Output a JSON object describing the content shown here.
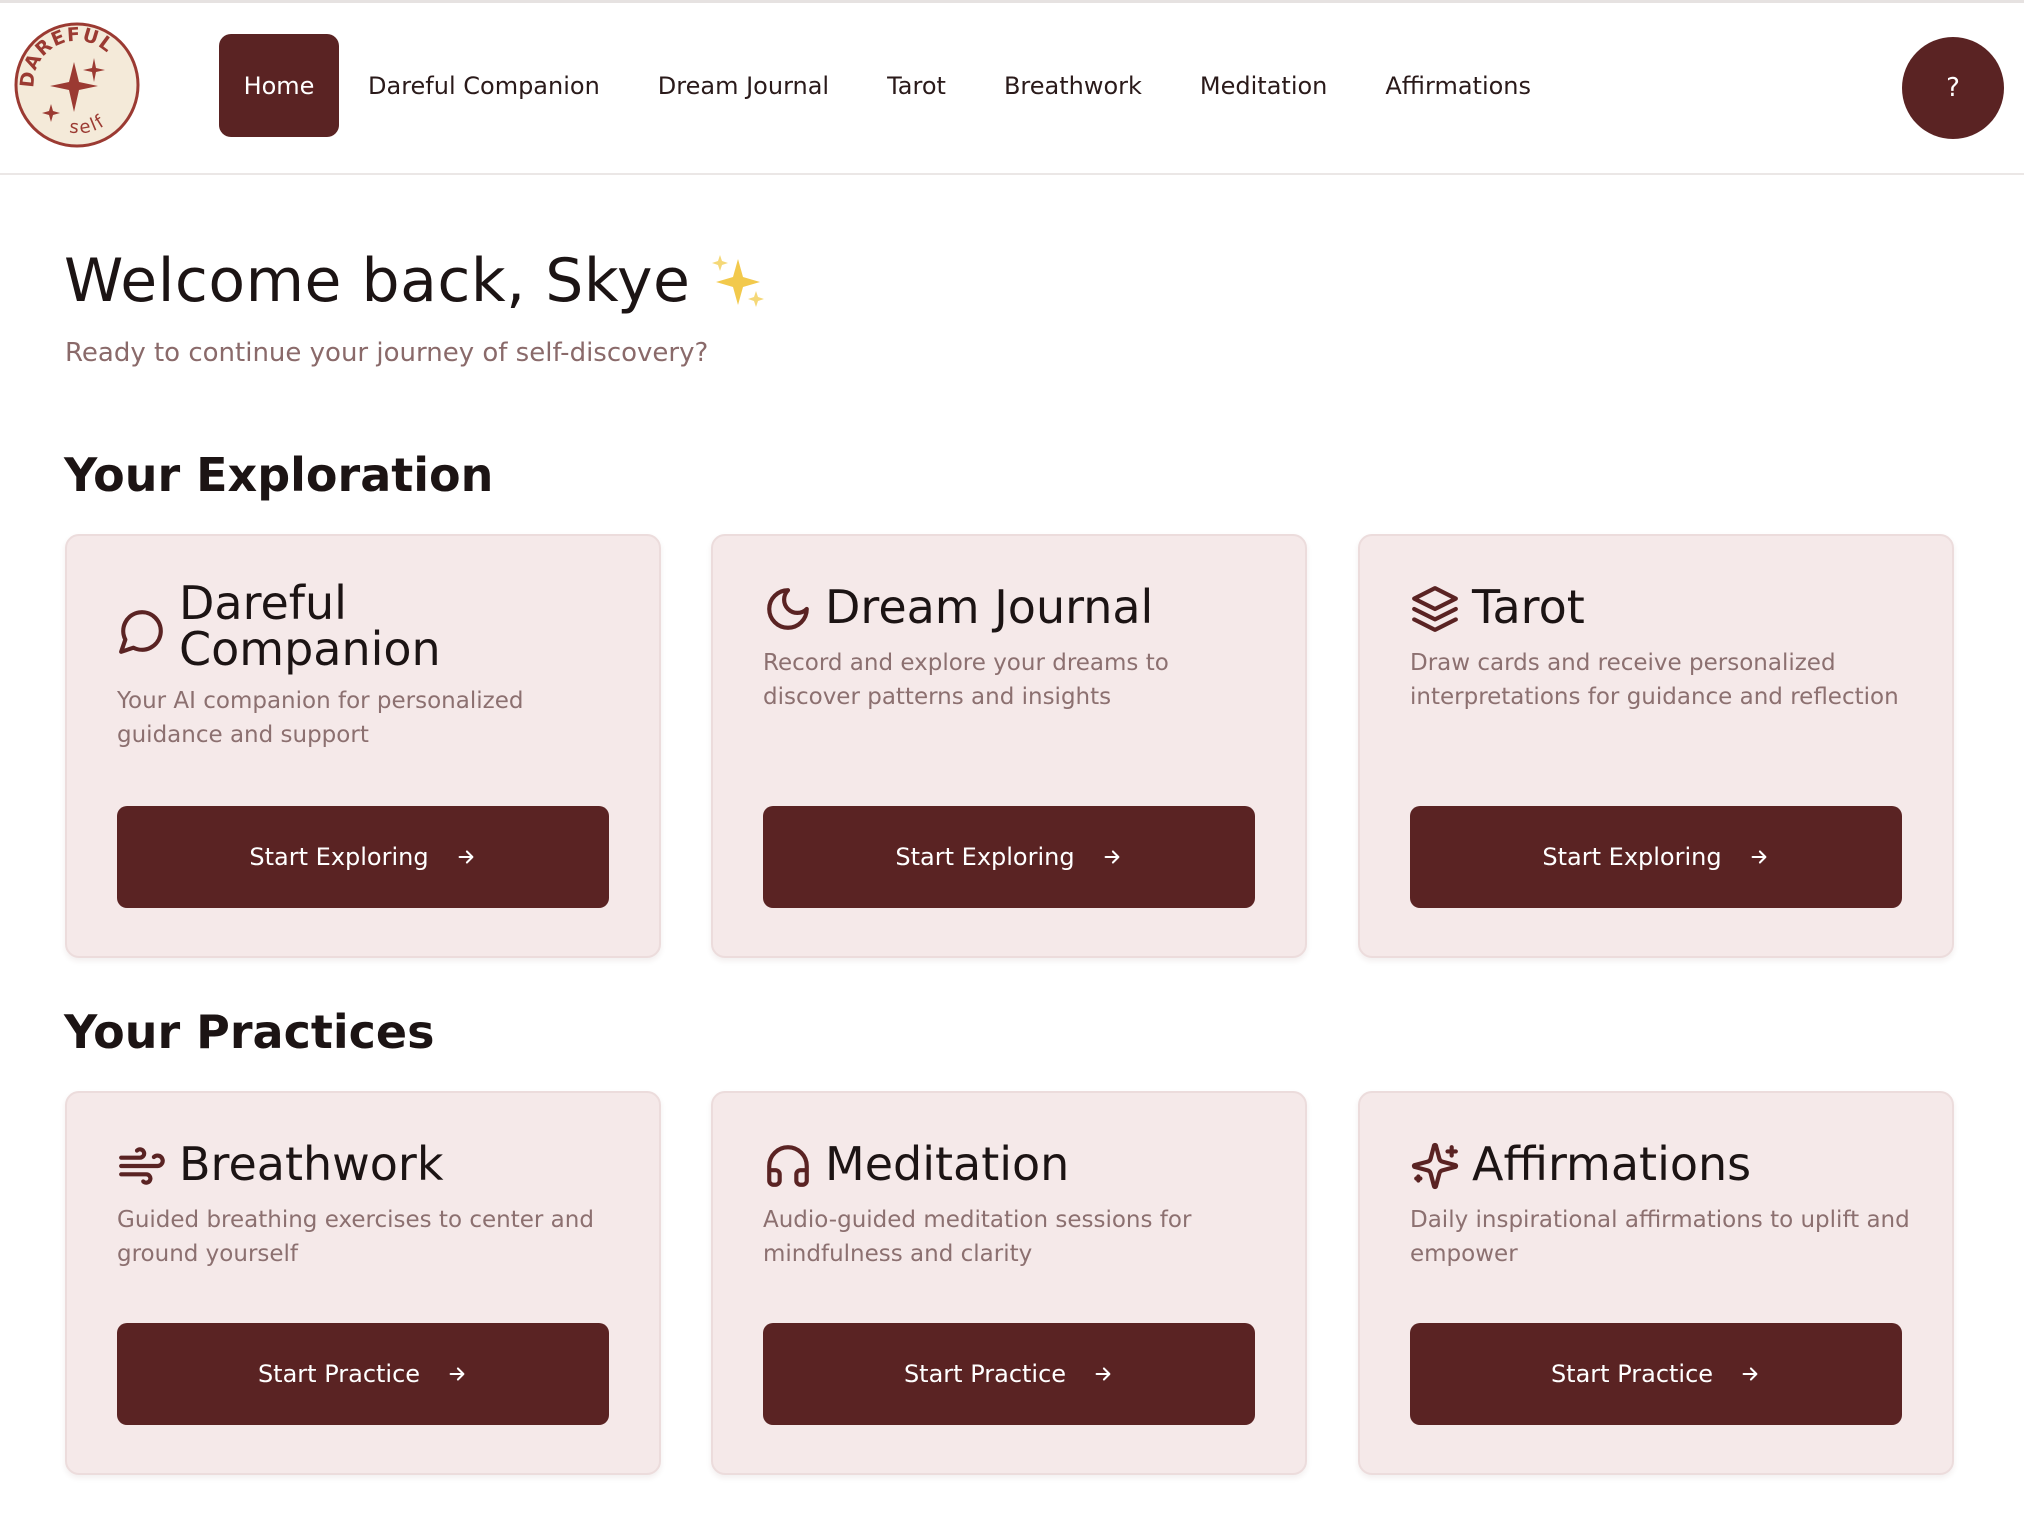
{
  "brand": {
    "logo_text_top": "DAREFUL",
    "logo_text_bottom": "self"
  },
  "nav": {
    "items": [
      {
        "label": "Home",
        "active": true
      },
      {
        "label": "Dareful Companion",
        "active": false
      },
      {
        "label": "Dream Journal",
        "active": false
      },
      {
        "label": "Tarot",
        "active": false
      },
      {
        "label": "Breathwork",
        "active": false
      },
      {
        "label": "Meditation",
        "active": false
      },
      {
        "label": "Affirmations",
        "active": false
      }
    ],
    "help_label": "?"
  },
  "hero": {
    "welcome": "Welcome back, Skye",
    "subtitle": "Ready to continue your journey of self-discovery?"
  },
  "exploration": {
    "title": "Your Exploration",
    "cards": [
      {
        "icon": "chat-bubble-icon",
        "title_line1": "Dareful",
        "title_line2": "Companion",
        "description": "Your AI companion for personalized guidance and support",
        "button": "Start Exploring"
      },
      {
        "icon": "moon-icon",
        "title": "Dream Journal",
        "description": "Record and explore your dreams to discover patterns and insights",
        "button": "Start Exploring"
      },
      {
        "icon": "layers-icon",
        "title": "Tarot",
        "description": "Draw cards and receive personalized interpretations for guidance and reflection",
        "button": "Start Exploring"
      }
    ]
  },
  "practices": {
    "title": "Your Practices",
    "cards": [
      {
        "icon": "wind-icon",
        "title": "Breathwork",
        "description": "Guided breathing exercises to center and ground yourself",
        "button": "Start Practice"
      },
      {
        "icon": "headphones-icon",
        "title": "Meditation",
        "description": "Audio-guided meditation sessions for mindfulness and clarity",
        "button": "Start Practice"
      },
      {
        "icon": "sparkles-icon",
        "title": "Affirmations",
        "description": "Daily inspirational affirmations to uplift and empower",
        "button": "Start Practice"
      }
    ]
  },
  "colors": {
    "primary": "#5a2323",
    "card_bg": "#f5e9e9",
    "muted_text": "#8c7070",
    "sparkle": "#f2c94c"
  }
}
